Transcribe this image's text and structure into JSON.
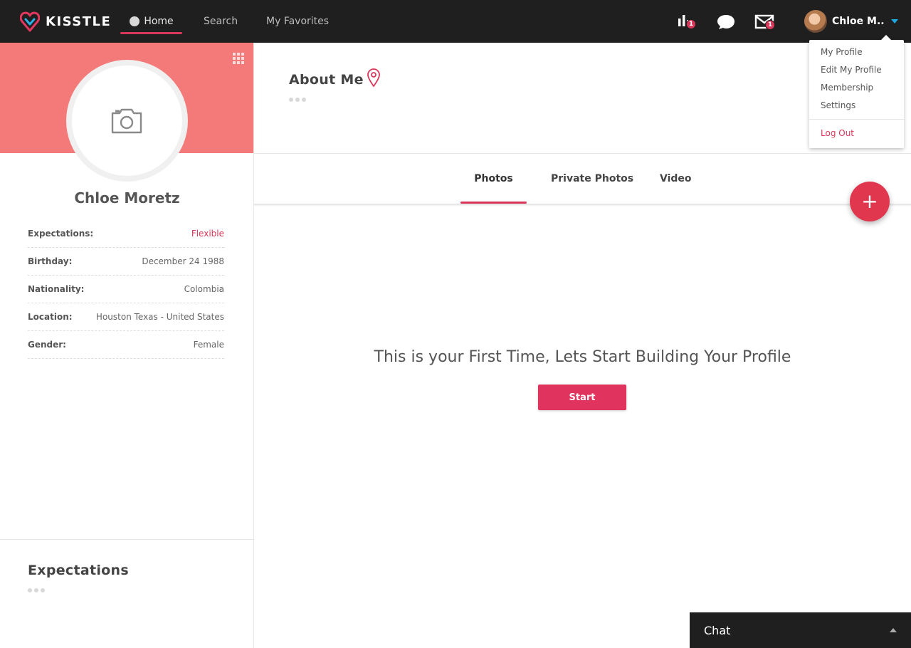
{
  "header": {
    "brand": "KISSTLE",
    "nav": {
      "home": "Home",
      "search": "Search",
      "favorites": "My Favorites"
    },
    "badges": {
      "stats": "1",
      "mail": "1"
    },
    "user_name": "Chloe M..",
    "icons": [
      "logo-heart-icon",
      "stats-icon",
      "chat-bubble-icon",
      "mail-icon",
      "caret-down-icon"
    ]
  },
  "dropdown": {
    "items": [
      "My Profile",
      "Edit My Profile",
      "Membership",
      "Settings"
    ],
    "logout": "Log Out"
  },
  "profile": {
    "name": "Chloe Moretz",
    "details": [
      {
        "label": "Expectations:",
        "value": "Flexible"
      },
      {
        "label": "Birthday:",
        "value": "December 24 1988"
      },
      {
        "label": "Nationality:",
        "value": "Colombia"
      },
      {
        "label": "Location:",
        "value": "Houston Texas - United States"
      },
      {
        "label": "Gender:",
        "value": "Female"
      }
    ],
    "expectations_title": "Expectations"
  },
  "main": {
    "about_title": "About Me",
    "tabs": [
      "Photos",
      "Private Photos",
      "Video"
    ],
    "headline": "This is your First Time, Lets Start Building Your Profile",
    "start_label": "Start",
    "fab_label": "+"
  },
  "chat": {
    "label": "Chat"
  },
  "colors": {
    "accent": "#d9375a",
    "banner": "#f47a7a",
    "topbar": "#1f1f1f",
    "caret": "#1ea9e1"
  }
}
